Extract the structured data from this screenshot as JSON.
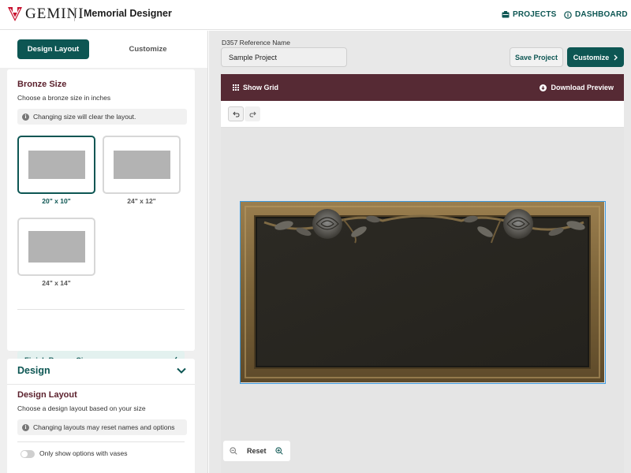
{
  "header": {
    "logo_text": "GEMINI",
    "app_title": "Memorial Designer",
    "nav": [
      {
        "label": "PROJECTS",
        "icon": "folder-icon"
      },
      {
        "label": "DASHBOARD",
        "icon": "info-circle-icon"
      }
    ]
  },
  "left_panel": {
    "tabs": [
      {
        "label": "Design Layout",
        "active": true
      },
      {
        "label": "Customize",
        "active": false
      }
    ],
    "bronze": {
      "title": "Bronze Size",
      "subtitle": "Choose a bronze size in inches",
      "notice": "Changing size will clear the layout.",
      "options": [
        {
          "label": "20\" x 10\"",
          "selected": true
        },
        {
          "label": "24\" x 12\"",
          "selected": false
        },
        {
          "label": "24\" x 14\"",
          "selected": false
        }
      ],
      "finish_label": "Finish Bronze Size"
    },
    "design": {
      "heading": "Design",
      "layout_title": "Design Layout",
      "layout_subtitle": "Choose a design layout based on your size",
      "notice": "Changing layouts may reset names and options",
      "toggle_label": "Only show options with vases",
      "toggle_on": false
    }
  },
  "workspace": {
    "reference_label": "D357 Reference Name",
    "reference_value": "Sample Project",
    "save_label": "Save Project",
    "customize_label": "Customize",
    "show_grid_label": "Show Grid",
    "download_label": "Download Preview",
    "reset_label": "Reset"
  },
  "colors": {
    "accent": "#0d5653",
    "toolbar": "#562a34",
    "selection": "#3e9be0",
    "section_title": "#5a1f2b"
  }
}
